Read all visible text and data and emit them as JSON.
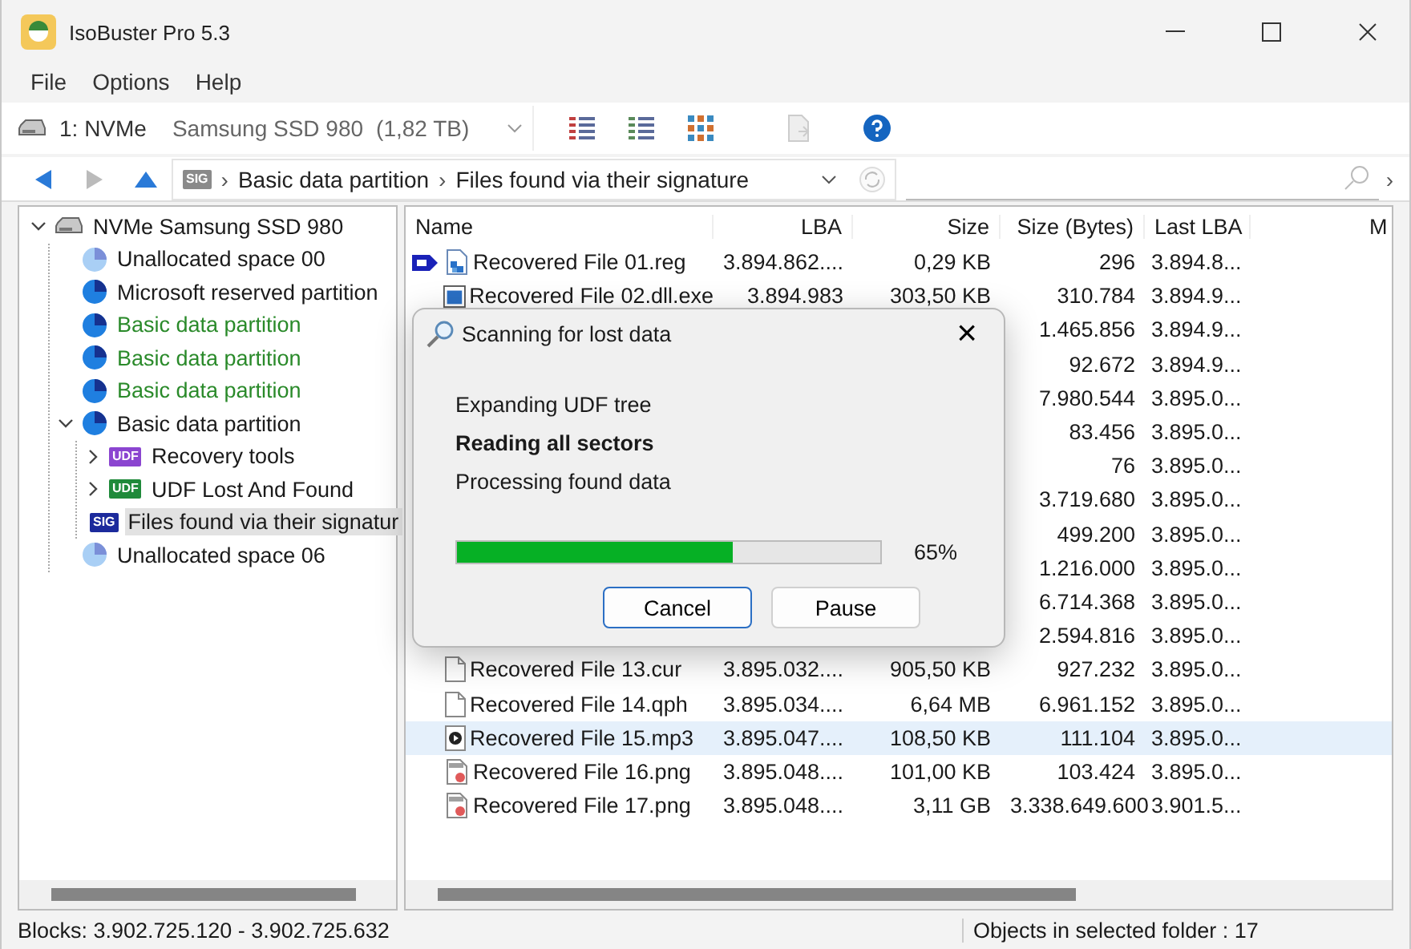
{
  "window": {
    "title": "IsoBuster Pro 5.3"
  },
  "menu": [
    "File",
    "Options",
    "Help"
  ],
  "device": {
    "id": "1: NVMe",
    "model": "Samsung SSD 980",
    "size": "(1,82 TB)"
  },
  "nav": {
    "back_disabled": false,
    "forward_disabled": true,
    "breadcrumb_tag": "SIG",
    "separator": "›",
    "breadcrumb": [
      "Basic data partition",
      "Files found via their signature"
    ],
    "more": "›"
  },
  "tree": [
    {
      "label": "NVMe Samsung SSD 980",
      "kind": "disk",
      "color": "#1a1a1a",
      "expanded": true,
      "selected": false,
      "children": [
        {
          "label": "Unallocated space 00",
          "kind": "free",
          "color": "#1a1a1a",
          "selected": false
        },
        {
          "label": "Microsoft reserved partition",
          "kind": "partition",
          "color": "#1a1a1a",
          "selected": false
        },
        {
          "label": "Basic data partition",
          "kind": "partition",
          "color": "#2a8a2a",
          "selected": false
        },
        {
          "label": "Basic data partition",
          "kind": "partition",
          "color": "#2a8a2a",
          "selected": false
        },
        {
          "label": "Basic data partition",
          "kind": "partition",
          "color": "#2a8a2a",
          "selected": false
        },
        {
          "label": "Basic data partition",
          "kind": "partition",
          "color": "#1a1a1a",
          "expanded": true,
          "selected": false,
          "children": [
            {
              "label": "Recovery tools",
              "tag": {
                "text": "UDF",
                "color": "#8b45d0"
              },
              "color": "#1a1a1a",
              "expanded": false,
              "selected": false
            },
            {
              "label": "UDF Lost And Found",
              "tag": {
                "text": "UDF",
                "color": "#1f8a3a"
              },
              "color": "#1a1a1a",
              "expanded": false,
              "selected": false
            },
            {
              "label": "Files found via their signatur",
              "tag": {
                "text": "SIG",
                "color": "#1c2a9c"
              },
              "color": "#1a1a1a",
              "selected": true
            }
          ]
        },
        {
          "label": "Unallocated space 06",
          "kind": "free",
          "color": "#1a1a1a",
          "selected": false
        }
      ]
    }
  ],
  "table": {
    "columns": [
      "Name",
      "LBA",
      "Size",
      "Size (Bytes)",
      "Last LBA",
      "M"
    ],
    "rows": [
      {
        "kind": "reg",
        "current": true,
        "selected": false,
        "name": "Recovered File 01.reg",
        "lba": "3.894.862....",
        "size": "0,29 KB",
        "bytes": "296",
        "last_lba": "3.894.8..."
      },
      {
        "kind": "exe",
        "current": false,
        "selected": false,
        "name": "Recovered File 02.dll.exe",
        "lba": "3.894.983",
        "size": "303,50 KB",
        "bytes": "310.784",
        "last_lba": "3.894.9..."
      },
      {
        "kind": "hidden",
        "current": false,
        "selected": false,
        "bytes": "1.465.856",
        "last_lba": "3.894.9..."
      },
      {
        "kind": "hidden",
        "current": false,
        "selected": false,
        "bytes": "92.672",
        "last_lba": "3.894.9..."
      },
      {
        "kind": "hidden",
        "current": false,
        "selected": false,
        "bytes": "7.980.544",
        "last_lba": "3.895.0..."
      },
      {
        "kind": "hidden",
        "current": false,
        "selected": false,
        "bytes": "83.456",
        "last_lba": "3.895.0..."
      },
      {
        "kind": "hidden",
        "current": false,
        "selected": false,
        "bytes": "76",
        "last_lba": "3.895.0..."
      },
      {
        "kind": "hidden",
        "current": false,
        "selected": false,
        "bytes": "3.719.680",
        "last_lba": "3.895.0..."
      },
      {
        "kind": "hidden",
        "current": false,
        "selected": false,
        "bytes": "499.200",
        "last_lba": "3.895.0..."
      },
      {
        "kind": "hidden",
        "current": false,
        "selected": false,
        "bytes": "1.216.000",
        "last_lba": "3.895.0..."
      },
      {
        "kind": "hidden",
        "current": false,
        "selected": false,
        "bytes": "6.714.368",
        "last_lba": "3.895.0..."
      },
      {
        "kind": "hidden",
        "current": false,
        "selected": false,
        "bytes": "2.594.816",
        "last_lba": "3.895.0..."
      },
      {
        "kind": "blank",
        "current": false,
        "selected": false,
        "name": "Recovered File 13.cur",
        "lba": "3.895.032....",
        "size": "905,50 KB",
        "bytes": "927.232",
        "last_lba": "3.895.0..."
      },
      {
        "kind": "blank",
        "current": false,
        "selected": false,
        "name": "Recovered File 14.qph",
        "lba": "3.895.034....",
        "size": "6,64 MB",
        "bytes": "6.961.152",
        "last_lba": "3.895.0..."
      },
      {
        "kind": "audio",
        "current": false,
        "selected": true,
        "name": "Recovered File 15.mp3",
        "lba": "3.895.047....",
        "size": "108,50 KB",
        "bytes": "111.104",
        "last_lba": "3.895.0..."
      },
      {
        "kind": "image",
        "current": false,
        "selected": false,
        "name": "Recovered File 16.png",
        "lba": "3.895.048....",
        "size": "101,00 KB",
        "bytes": "103.424",
        "last_lba": "3.895.0..."
      },
      {
        "kind": "image",
        "current": false,
        "selected": false,
        "name": "Recovered File 17.png",
        "lba": "3.895.048....",
        "size": "3,11 GB",
        "bytes": "3.338.649.600",
        "last_lba": "3.901.5..."
      }
    ]
  },
  "dialog": {
    "title": "Scanning for lost data",
    "close": "×",
    "steps": [
      {
        "text": "Expanding UDF tree",
        "current": false
      },
      {
        "text": "Reading all sectors",
        "current": true
      },
      {
        "text": "Processing found data",
        "current": false
      }
    ],
    "progress": {
      "level": 0.65,
      "reading": "65%"
    },
    "buttons": [
      {
        "label": "Cancel",
        "default": true
      },
      {
        "label": "Pause",
        "default": false
      }
    ]
  },
  "status_bar": {
    "blocks": "Blocks: 3.902.725.120 - 3.902.725.632",
    "objects": "Objects in selected folder : 17"
  }
}
